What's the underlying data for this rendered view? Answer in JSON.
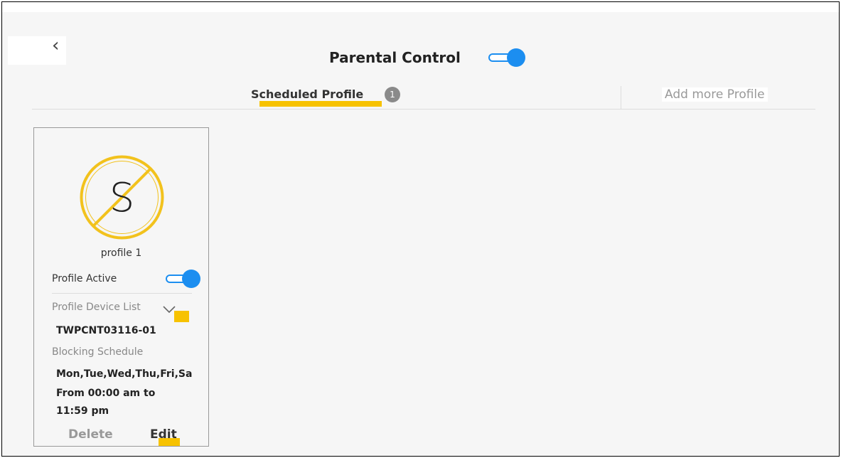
{
  "header": {
    "title": "Parental Control",
    "parental_control_enabled": true
  },
  "tabs": {
    "scheduled_label": "Scheduled Profile",
    "scheduled_count": "1",
    "add_more_label": "Add more Profile"
  },
  "profiles": [
    {
      "avatar_letter": "S",
      "name": "profile 1",
      "active_label": "Profile Active",
      "active": true,
      "device_list_label": "Profile Device List",
      "device": "TWPCNT03116-01",
      "schedule_label": "Blocking Schedule",
      "schedule_days": "Mon,Tue,Wed,Thu,Fri,Sa",
      "schedule_from": "From 00:00 am to",
      "schedule_to": "11:59 pm",
      "delete_label": "Delete",
      "edit_label": "Edit"
    }
  ],
  "colors": {
    "accent_blue": "#1c8ef0",
    "highlight_yellow": "#f7c200",
    "avatar_yellow": "#f2c21d"
  },
  "icons": {
    "back": "chevron-left-icon",
    "device_list_expand": "chevron-down-icon",
    "avatar": "profile-avatar-icon"
  }
}
